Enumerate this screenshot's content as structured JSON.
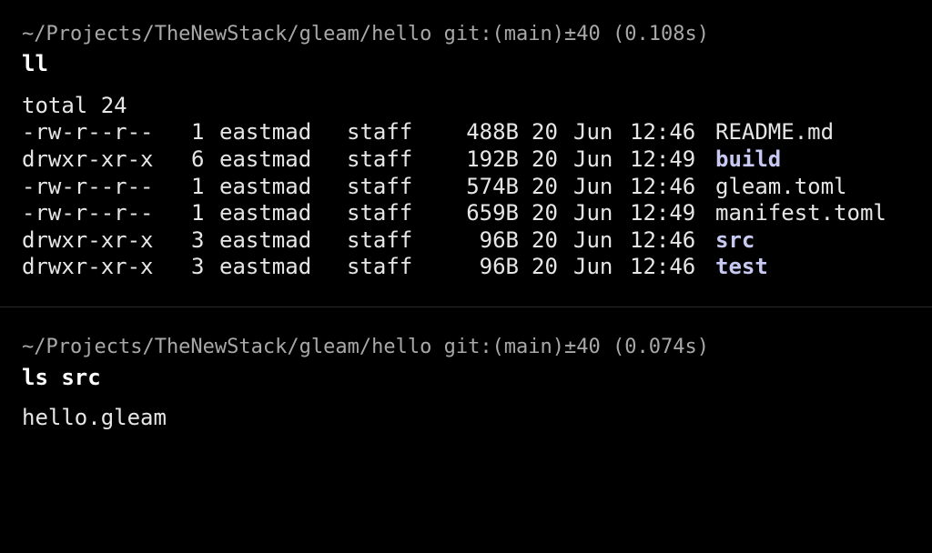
{
  "colors": {
    "background": "#000000",
    "text": "#e6e6e6",
    "prompt": "#a8a8a8",
    "directory": "#c7c9f2"
  },
  "session1": {
    "prompt": "~/Projects/TheNewStack/gleam/hello git:(main)±40 (0.108s)",
    "command": "ll",
    "total": "total 24",
    "rows": [
      {
        "perm": "-rw-r--r--",
        "links": "1",
        "owner": "eastmad",
        "group": "staff",
        "size": "488B",
        "day": "20",
        "month": "Jun",
        "time": "12:46",
        "name": "README.md",
        "is_dir": false
      },
      {
        "perm": "drwxr-xr-x",
        "links": "6",
        "owner": "eastmad",
        "group": "staff",
        "size": "192B",
        "day": "20",
        "month": "Jun",
        "time": "12:49",
        "name": "build",
        "is_dir": true
      },
      {
        "perm": "-rw-r--r--",
        "links": "1",
        "owner": "eastmad",
        "group": "staff",
        "size": "574B",
        "day": "20",
        "month": "Jun",
        "time": "12:46",
        "name": "gleam.toml",
        "is_dir": false
      },
      {
        "perm": "-rw-r--r--",
        "links": "1",
        "owner": "eastmad",
        "group": "staff",
        "size": "659B",
        "day": "20",
        "month": "Jun",
        "time": "12:49",
        "name": "manifest.toml",
        "is_dir": false
      },
      {
        "perm": "drwxr-xr-x",
        "links": "3",
        "owner": "eastmad",
        "group": "staff",
        "size": "96B",
        "day": "20",
        "month": "Jun",
        "time": "12:46",
        "name": "src",
        "is_dir": true
      },
      {
        "perm": "drwxr-xr-x",
        "links": "3",
        "owner": "eastmad",
        "group": "staff",
        "size": "96B",
        "day": "20",
        "month": "Jun",
        "time": "12:46",
        "name": "test",
        "is_dir": true
      }
    ]
  },
  "session2": {
    "prompt": "~/Projects/TheNewStack/gleam/hello git:(main)±40 (0.074s)",
    "command": "ls src",
    "output": "hello.gleam"
  }
}
